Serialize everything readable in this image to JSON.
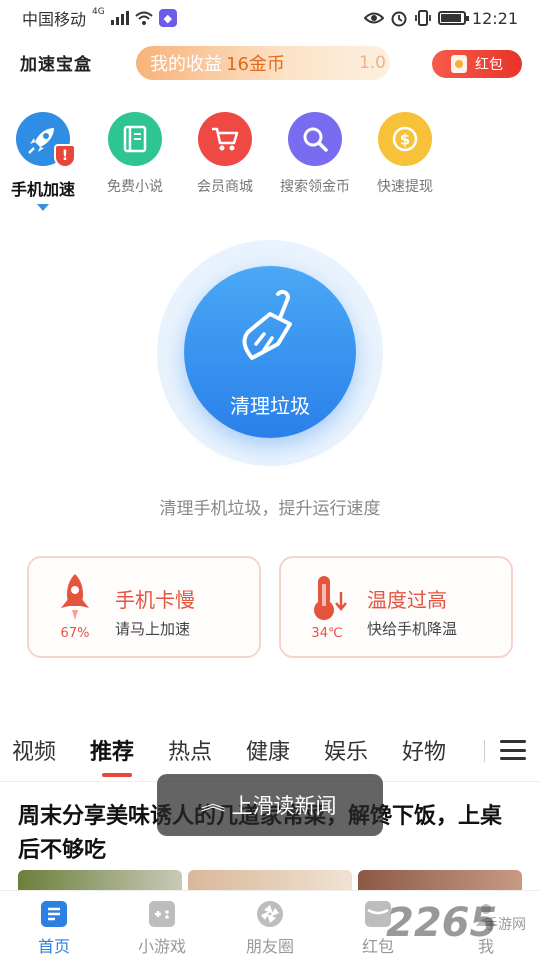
{
  "status_bar": {
    "carrier": "中国移动",
    "network": "4G",
    "time": "12:21",
    "battery_level": 0.85
  },
  "header": {
    "app_name": "加速宝盒",
    "earnings_label": "我的收益",
    "earnings_value": "16金币",
    "earnings_extra": "1.0",
    "red_packet_label": "红包"
  },
  "features": [
    {
      "label": "手机加速",
      "icon": "rocket-icon",
      "color": "#2f8de4",
      "active": true
    },
    {
      "label": "免费小说",
      "icon": "book-icon",
      "color": "#2fc592",
      "active": false
    },
    {
      "label": "会员商城",
      "icon": "cart-icon",
      "color": "#ee4a43",
      "active": false
    },
    {
      "label": "搜索领金币",
      "icon": "search-icon",
      "color": "#7a6cf0",
      "active": false
    },
    {
      "label": "快速提现",
      "icon": "dollar-coin-icon",
      "color": "#f7c23a",
      "active": false
    }
  ],
  "clean": {
    "button_label": "清理垃圾",
    "subtitle": "清理手机垃圾，提升运行速度"
  },
  "cards": [
    {
      "title": "手机卡慢",
      "subtitle": "请马上加速",
      "metric": "67%",
      "icon": "rocket-icon"
    },
    {
      "title": "温度过高",
      "subtitle": "快给手机降温",
      "metric": "34℃",
      "icon": "thermometer-icon"
    }
  ],
  "tabs": [
    "视频",
    "推荐",
    "热点",
    "健康",
    "娱乐",
    "好物"
  ],
  "active_tab": "推荐",
  "toast": {
    "text": "上滑读新闻"
  },
  "article": {
    "title": "周末分享美味诱人的几道家常菜，解馋下饭，上桌后不够吃"
  },
  "bottom_nav": [
    {
      "label": "首页",
      "icon": "home-news-icon",
      "active": true
    },
    {
      "label": "小游戏",
      "icon": "gamepad-icon",
      "active": false
    },
    {
      "label": "朋友圈",
      "icon": "aperture-icon",
      "active": false
    },
    {
      "label": "红包",
      "icon": "red-packet-icon",
      "active": false
    },
    {
      "label": "我",
      "icon": "user-icon",
      "active": false
    }
  ],
  "watermark": {
    "number": "2265",
    "text": "手游网"
  },
  "colors": {
    "accent_blue": "#2c7fe3",
    "accent_red": "#e5543f",
    "earnings_orange": "#e06b1d"
  }
}
